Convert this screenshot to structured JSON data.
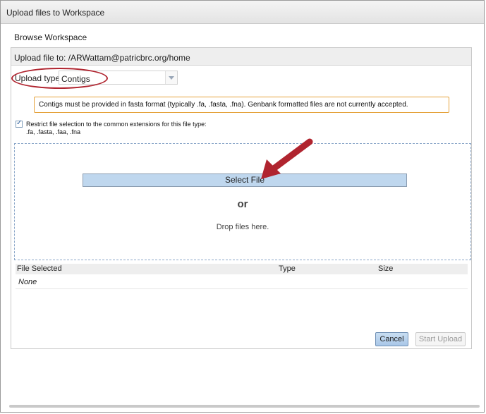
{
  "dialog": {
    "title": "Upload files to Workspace"
  },
  "browse_label": "Browse Workspace",
  "panel": {
    "header": "Upload file to: /ARWattam@patricbrc.org/home",
    "upload_type_label": "Upload type:",
    "upload_type_value": "Contigs",
    "warning": "Contigs must be provided in fasta format (typically .fa, .fasta, .fna). Genbank formatted files are not currently accepted.",
    "restrict_line1": "Restrict file selection to the common extensions for this file type:",
    "restrict_line2": ".fa, .fasta, .faa, .fna",
    "restrict_checked": true
  },
  "dropzone": {
    "select_file": "Select File",
    "or": "or",
    "drop_text": "Drop files here."
  },
  "grid": {
    "columns": [
      "File Selected",
      "Type",
      "Size"
    ],
    "rows": [
      [
        "None",
        "",
        ""
      ]
    ]
  },
  "buttons": {
    "cancel": "Cancel",
    "start_upload": "Start Upload"
  },
  "colors": {
    "highlight": "#b0242f",
    "warning_border": "#e5a23b",
    "select_file_bg": "#bfd7ee"
  }
}
